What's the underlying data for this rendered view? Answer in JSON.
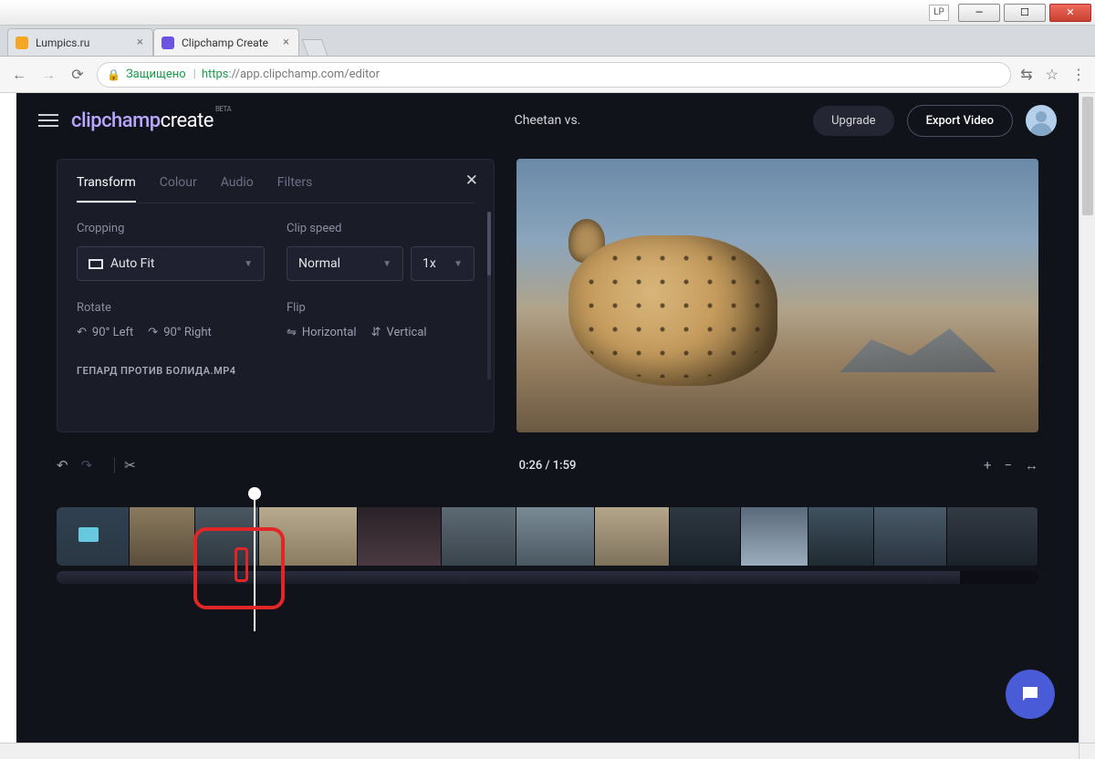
{
  "window": {
    "lp_badge": "LP",
    "minimize": "—",
    "maximize": "☐",
    "close": "✕"
  },
  "browser": {
    "tabs": [
      {
        "title": "Lumpics.ru"
      },
      {
        "title": "Clipchamp Create"
      }
    ],
    "nav": {
      "back": "←",
      "forward": "→",
      "reload": "⟳"
    },
    "secure_label": "Защищено",
    "url_proto": "https",
    "url_rest": "://app.clipchamp.com/editor",
    "actions": {
      "translate": "⇆",
      "star": "☆",
      "menu": "⋮"
    }
  },
  "app": {
    "logo1": "clipchamp",
    "logo2": "create",
    "logo_sup": "BETA",
    "project_title": "Cheetan vs.",
    "upgrade": "Upgrade",
    "export": "Export Video"
  },
  "panel": {
    "close": "✕",
    "tabs": [
      "Transform",
      "Colour",
      "Audio",
      "Filters"
    ],
    "cropping_label": "Cropping",
    "cropping_value": "Auto Fit",
    "clipspeed_label": "Clip speed",
    "clipspeed_value": "Normal",
    "clipspeed_mult": "1x",
    "rotate_label": "Rotate",
    "rotate_left": "90° Left",
    "rotate_right": "90° Right",
    "flip_label": "Flip",
    "flip_h": "Horizontal",
    "flip_v": "Vertical",
    "filename": "ГЕПАРД ПРОТИВ БОЛИДА.MP4"
  },
  "timeline": {
    "undo": "↶",
    "redo": "↷",
    "cut": "✂",
    "time": "0:26 / 1:59",
    "zoom_in": "+",
    "zoom_out": "−",
    "fit": "↔"
  }
}
